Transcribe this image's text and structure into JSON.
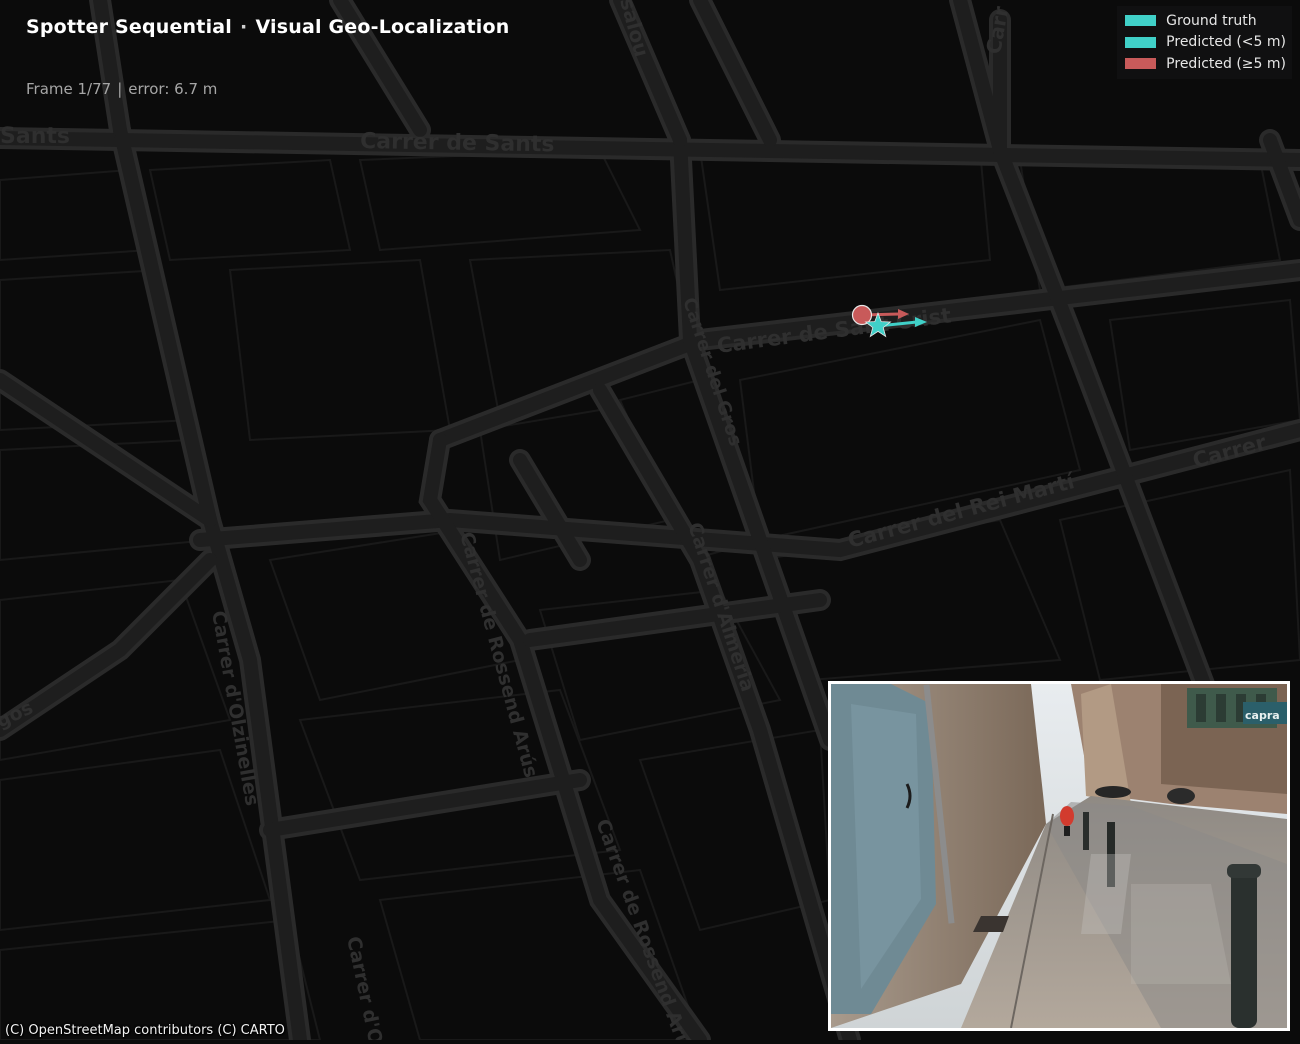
{
  "header": {
    "app_name": "Spotter Sequential",
    "separator": "·",
    "subtitle": "Visual Geo-Localization"
  },
  "status": {
    "frame_label": "Frame 1/77",
    "separator": "|",
    "error_label": "error: 6.7 m"
  },
  "legend": {
    "items": [
      {
        "label": "Ground truth",
        "color": "#40d0c8"
      },
      {
        "label": "Predicted  (<5 m)",
        "color": "#40d0c8"
      },
      {
        "label": "Predicted  (≥5 m)",
        "color": "#c85a5a"
      }
    ]
  },
  "map": {
    "street_labels": {
      "sants_top": "Carrer de Sants",
      "sants_left": "Sants",
      "salou": "salou",
      "carr_top_right": "Carr",
      "sant_crist": "Carrer de Sant Crist",
      "del_gros": "Carrer del Gros",
      "rei_marti": "Carrer del Rei Martí",
      "carrer_right": "Carrer",
      "rossend_arus_1": "Carrer de Rossend Arús",
      "olzinelles": "Carrer d'Olzinelles",
      "almeria": "Carrer d'Almeria",
      "rossend_arus_2": "Carrer de Rossend Arús",
      "carrer_bottom": "Carrer d'O",
      "gos": "gos"
    },
    "colors": {
      "background": "#0b0b0b",
      "street": "#1f1f1f",
      "street_edge": "#2b2b2b",
      "block_line": "#1a1a1a",
      "label": "#2f2f2f"
    },
    "markers": {
      "ground_truth": {
        "shape": "star",
        "color": "#40d0c8"
      },
      "prediction": {
        "shape": "circle",
        "color": "#c85a5a",
        "within_threshold": false
      }
    }
  },
  "inset": {
    "icon": "street-view-photo",
    "colors": {
      "border": "#ffffff",
      "wall": "#8d7a66",
      "sky": "#dfe4e8",
      "pavement": "#9b9288",
      "door": "#6f8a94"
    },
    "shop_sign": "capra"
  },
  "attribution": {
    "text": "(C) OpenStreetMap contributors (C) CARTO"
  }
}
